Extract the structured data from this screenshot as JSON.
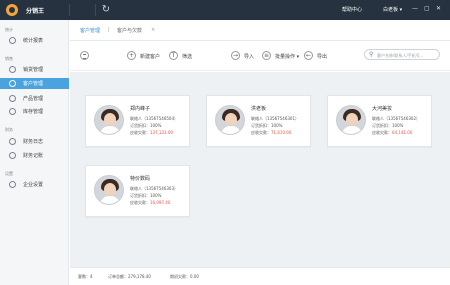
{
  "app": {
    "title": "分销王"
  },
  "titlebar": {
    "help": "帮助中心",
    "user": "白老板 ▾",
    "min": "—",
    "max": "▢",
    "close": "✕"
  },
  "sidebar": {
    "sections": [
      {
        "label": "统计"
      },
      {
        "label": "销售"
      },
      {
        "label": "财务"
      },
      {
        "label": "设置"
      }
    ],
    "items": [
      {
        "label": "统计报表"
      },
      {
        "label": "销货管理"
      },
      {
        "label": "客户管理"
      },
      {
        "label": "产品管理"
      },
      {
        "label": "库存管理"
      },
      {
        "label": "财务日志"
      },
      {
        "label": "财务记账"
      },
      {
        "label": "企业设置"
      }
    ]
  },
  "breadcrumb": {
    "first": "客户管理",
    "second": "客户与欠款",
    "close": "×"
  },
  "toolbar": {
    "new": "新建客户",
    "filter": "筛选",
    "import": "导入",
    "batch": "批量操作 ▾",
    "export": "导出",
    "search_placeholder": "客户名称/联系人/手机号..."
  },
  "cards": [
    {
      "name": "郑内峰子",
      "phone_label": "联络人（13567546504）",
      "rate": "订货折扣：100%",
      "debt_label": "应收欠款：",
      "debt": "137,133.00"
    },
    {
      "name": "洪老板",
      "phone_label": "联络人（13567546301）",
      "rate": "订货折扣：100%",
      "debt_label": "应收欠款：",
      "debt": "71,610.00"
    },
    {
      "name": "大河美妆",
      "phone_label": "联络人（13567546302）",
      "rate": "订货折扣：100%",
      "debt_label": "应收欠款：",
      "debt": "64,141.00"
    },
    {
      "name": "特价数码",
      "phone_label": "联络人（13567546303）",
      "rate": "订货折扣：100%",
      "debt_label": "应收欠款：",
      "debt": "16,097.40"
    }
  ],
  "footer": {
    "count": "客数：4",
    "total": "订单总额：279,178.40",
    "paid": "期初欠款：0.00"
  },
  "colors": {
    "titlebar": "#263240",
    "active": "#4aa3df",
    "amount": "#e2564a",
    "link": "#3b8fd6"
  }
}
